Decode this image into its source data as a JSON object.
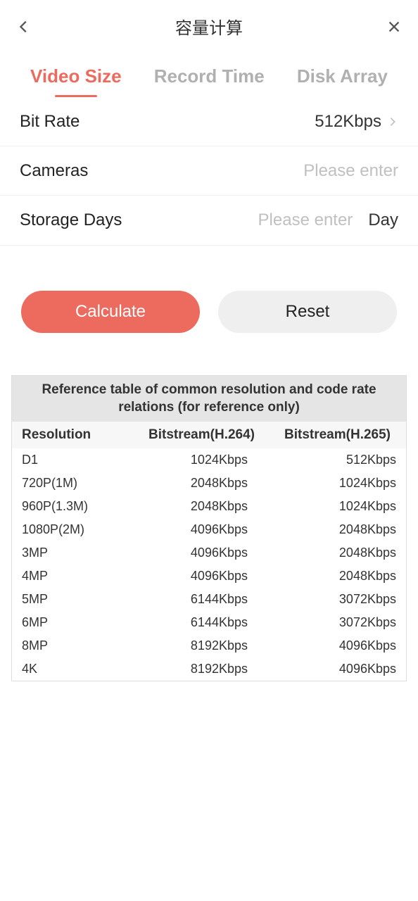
{
  "header": {
    "title": "容量计算"
  },
  "tabs": {
    "video_size": "Video Size",
    "record_time": "Record Time",
    "disk_array": "Disk Array"
  },
  "form": {
    "bit_rate": {
      "label": "Bit Rate",
      "value": "512Kbps"
    },
    "cameras": {
      "label": "Cameras",
      "placeholder": "Please enter"
    },
    "storage_days": {
      "label": "Storage Days",
      "placeholder": "Please enter",
      "unit": "Day"
    }
  },
  "buttons": {
    "calculate": "Calculate",
    "reset": "Reset"
  },
  "reference": {
    "title": "Reference table of common resolution and code rate relations (for reference only)",
    "columns": {
      "resolution": "Resolution",
      "h264": "Bitstream(H.264)",
      "h265": "Bitstream(H.265)"
    },
    "rows": [
      {
        "res": "D1",
        "h264": "1024Kbps",
        "h265": "512Kbps"
      },
      {
        "res": "720P(1M)",
        "h264": "2048Kbps",
        "h265": "1024Kbps"
      },
      {
        "res": "960P(1.3M)",
        "h264": "2048Kbps",
        "h265": "1024Kbps"
      },
      {
        "res": "1080P(2M)",
        "h264": "4096Kbps",
        "h265": "2048Kbps"
      },
      {
        "res": "3MP",
        "h264": "4096Kbps",
        "h265": "2048Kbps"
      },
      {
        "res": "4MP",
        "h264": "4096Kbps",
        "h265": "2048Kbps"
      },
      {
        "res": "5MP",
        "h264": "6144Kbps",
        "h265": "3072Kbps"
      },
      {
        "res": "6MP",
        "h264": "6144Kbps",
        "h265": "3072Kbps"
      },
      {
        "res": "8MP",
        "h264": "8192Kbps",
        "h265": "4096Kbps"
      },
      {
        "res": "4K",
        "h264": "8192Kbps",
        "h265": "4096Kbps"
      }
    ]
  }
}
